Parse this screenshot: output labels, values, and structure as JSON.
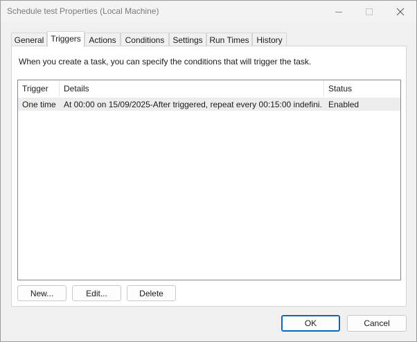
{
  "window": {
    "title": "Schedule test Properties (Local Machine)",
    "controls": {
      "minimize": "minimize-icon",
      "maximize": "maximize-icon",
      "close": "close-icon"
    }
  },
  "tabs": [
    {
      "label": "General"
    },
    {
      "label": "Triggers"
    },
    {
      "label": "Actions"
    },
    {
      "label": "Conditions"
    },
    {
      "label": "Settings"
    },
    {
      "label": "Run Times"
    },
    {
      "label": "History"
    }
  ],
  "active_tab": "Triggers",
  "triggers": {
    "description": "When you create a task, you can specify the conditions that will trigger the task.",
    "columns": {
      "trigger": "Trigger",
      "details": "Details",
      "status": "Status"
    },
    "rows": [
      {
        "trigger": "One time",
        "details": "At 00:00 on 15/09/2025-After triggered, repeat every 00:15:00 indefini...",
        "status": "Enabled"
      }
    ],
    "buttons": {
      "new": "New...",
      "edit": "Edit...",
      "delete": "Delete"
    }
  },
  "footer": {
    "ok": "OK",
    "cancel": "Cancel"
  },
  "colors": {
    "accent": "#0067c0",
    "selected_row": "#ededed",
    "dialog_bg": "#f0f0f0"
  }
}
